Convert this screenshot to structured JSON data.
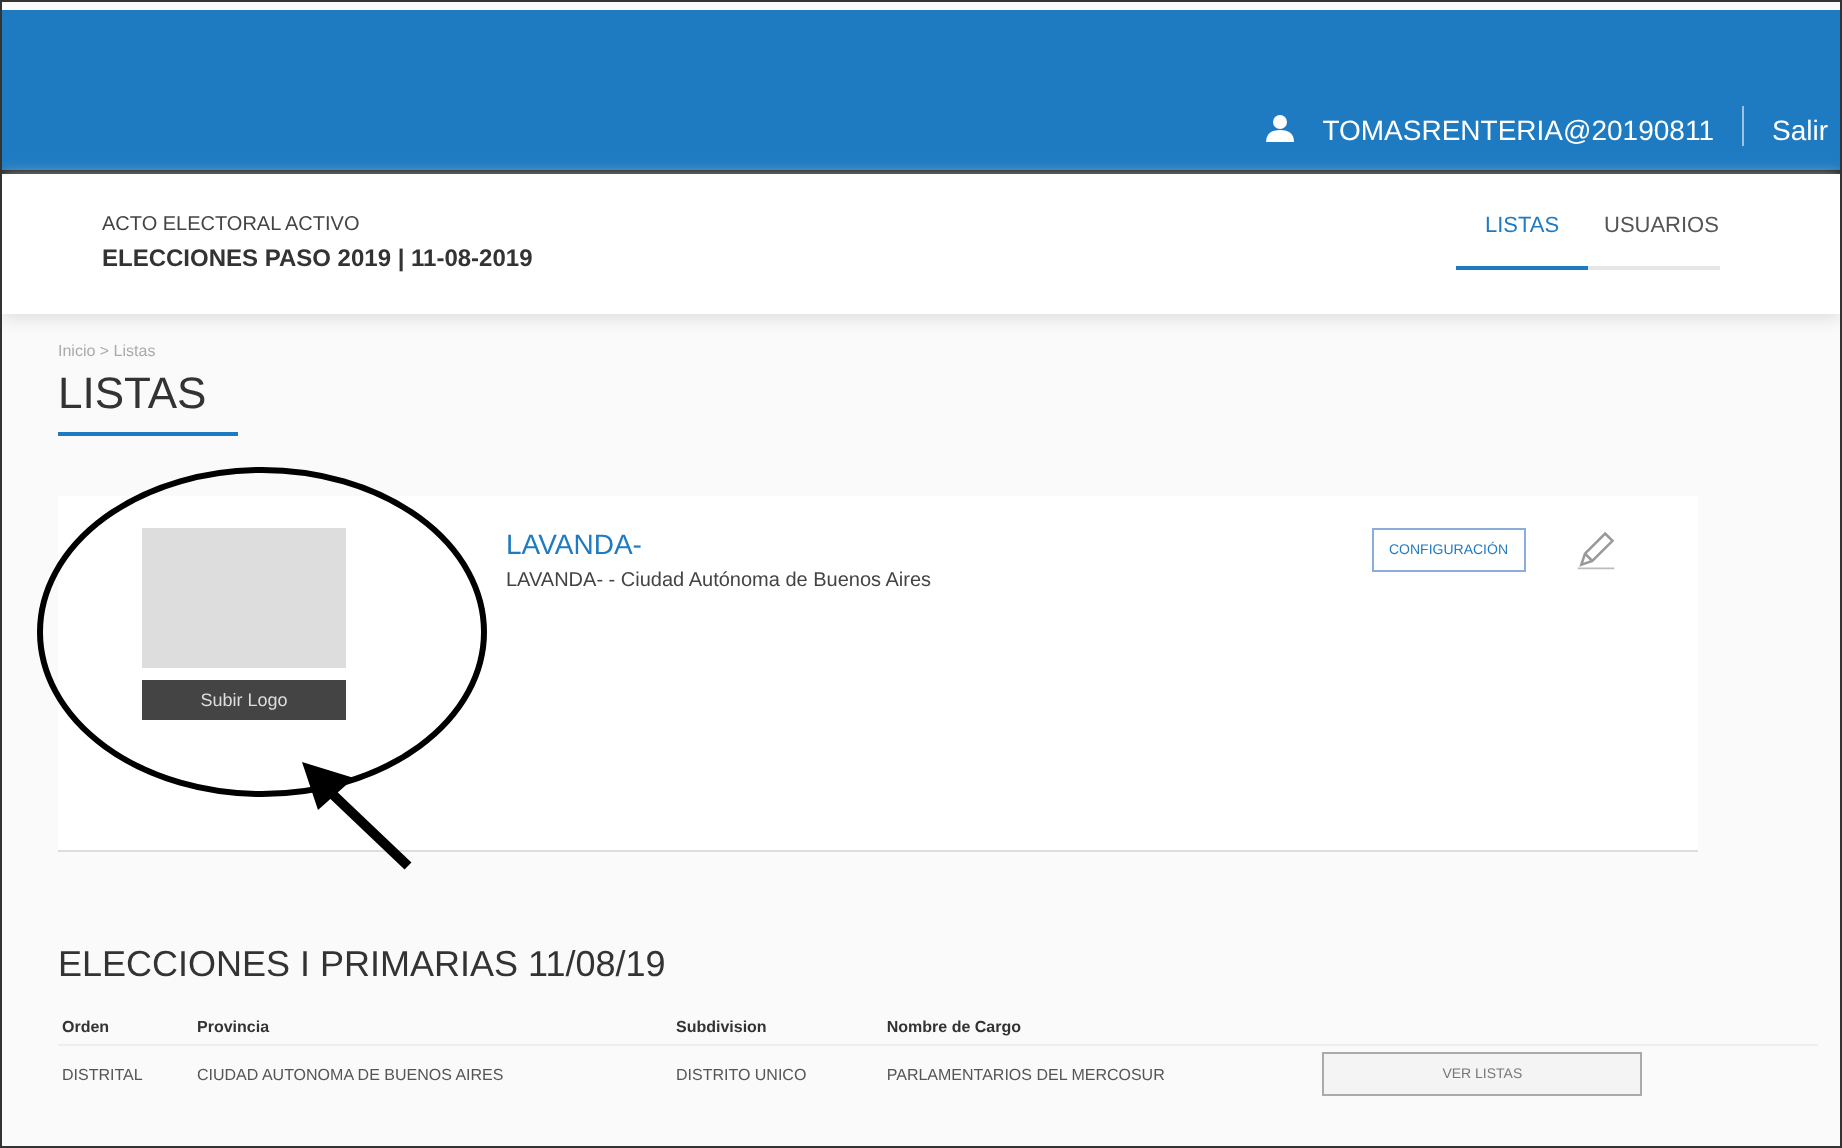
{
  "topbar": {
    "user": "TOMASRENTERIA@20190811",
    "logout": "Salir"
  },
  "context": {
    "label": "ACTO ELECTORAL ACTIVO",
    "election": "ELECCIONES PASO 2019 | 11-08-2019"
  },
  "tabs": [
    {
      "label": "LISTAS",
      "selected": true
    },
    {
      "label": "USUARIOS",
      "selected": false
    }
  ],
  "breadcrumb": "Inicio > Listas",
  "page_title": "LISTAS",
  "list_card": {
    "name": "LAVANDA-",
    "detail": "LAVANDA- - Ciudad Autónoma de Buenos Aires",
    "action": "CONFIGURACIÓN",
    "upload_button": "Subir Logo"
  },
  "section_title": "ELECCIONES I PRIMARIAS 11/08/19",
  "table": {
    "columns": [
      "Orden",
      "Provincia",
      "Subdivision",
      "Nombre de Cargo"
    ],
    "rows": [
      {
        "cells": [
          "DISTRITAL",
          "CIUDAD AUTONOMA DE BUENOS AIRES",
          "DISTRITO UNICO",
          "PARLAMENTARIOS DEL MERCOSUR"
        ],
        "button": "VER LISTAS"
      }
    ]
  }
}
